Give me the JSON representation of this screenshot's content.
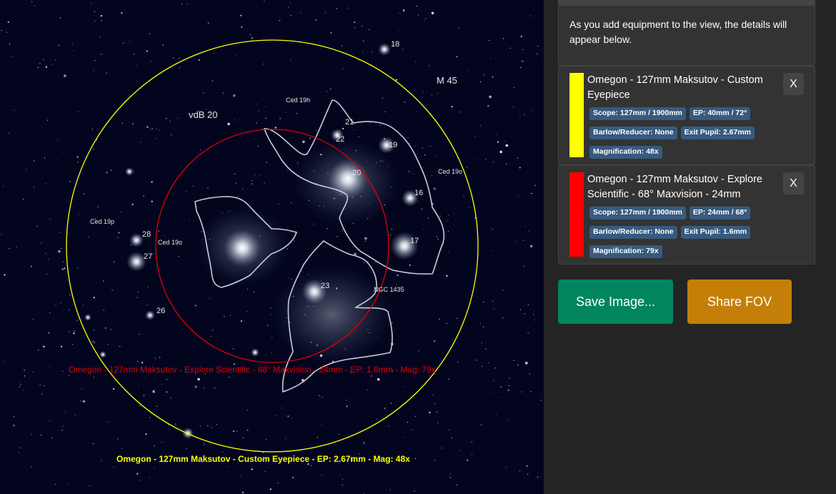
{
  "sky": {
    "labels": {
      "m45": "M 45",
      "vdb20": "vdB 20",
      "ced19h": "Ced 19h",
      "ced19o_right": "Ced 19o",
      "ced19p": "Ced 19p",
      "ced19o_left": "Ced 19o",
      "ngc1435": "NGC 1435",
      "n18": "18",
      "n21": "21",
      "n22": "22",
      "n19": "19",
      "n20": "20",
      "n16": "16",
      "n17": "17",
      "n23": "23",
      "n28": "28",
      "n27": "27",
      "n26": "26"
    },
    "fov_labels": {
      "red": "Omegon - 127mm Maksutov - Explore Scientific - 68° Maxvision - 24mm - EP: 1.6mm - Mag: 79x",
      "yellow": "Omegon - 127mm Maksutov - Custom Eyepiece - EP: 2.67mm - Mag: 48x"
    },
    "colors": {
      "background": "#03051f",
      "yellow_circle": "#ffff00",
      "red_circle": "#e00000"
    }
  },
  "sidebar": {
    "info_text": "As you add equipment to the view, the details will appear below.",
    "equipment": [
      {
        "color": "#ffff00",
        "title": "Omegon - 127mm Maksutov - Custom Eyepiece",
        "close_label": "X",
        "tags": [
          "Scope: 127mm / 1900mm",
          "EP: 40mm / 72°",
          "Barlow/Reducer: None",
          "Exit Pupil: 2.67mm",
          "Magnification: 48x"
        ]
      },
      {
        "color": "#ff0000",
        "title": "Omegon - 127mm Maksutov - Explore Scientific - 68° Maxvision - 24mm",
        "close_label": "X",
        "tags": [
          "Scope: 127mm / 1900mm",
          "EP: 24mm / 68°",
          "Barlow/Reducer: None",
          "Exit Pupil: 1.6mm",
          "Magnification: 79x"
        ]
      }
    ],
    "buttons": {
      "save": "Save Image...",
      "share": "Share FOV"
    },
    "colors": {
      "save": "#00855f",
      "share": "#c47f09",
      "tag": "#375a7f"
    }
  }
}
